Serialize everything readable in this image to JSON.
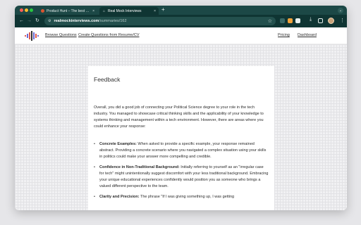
{
  "browser": {
    "tabs": [
      {
        "title": "Product Hunt – The best new",
        "favicon": "product-hunt-icon",
        "active": false
      },
      {
        "title": "Real Mock Interviews",
        "favicon": "site-icon",
        "active": true
      }
    ],
    "new_tab": "+",
    "tab_close": "×",
    "url": {
      "host": "realmockinterviews.com",
      "path": "/summaries/162"
    },
    "colors": {
      "frame": "#1c4846",
      "toolbar": "#0f3533",
      "omnibox": "#23504d"
    }
  },
  "site": {
    "nav": {
      "browse_questions": "Browse Questions",
      "create_from_resume": "Create Questions from Resume/CV",
      "pricing": "Pricing",
      "dashboard": "Dashboard"
    }
  },
  "feedback": {
    "title": "Feedback",
    "intro": "Overall, you did a good job of connecting your Political Science degree to your role in the tech industry. You managed to showcase critical thinking skills and the applicability of your knowledge to systems thinking and management within a tech environment. However, there are areas where you could enhance your response:",
    "items": [
      {
        "title": "Concrete Examples:",
        "body": "When asked to provide a specific example, your response remained abstract. Providing a concrete scenario where you navigated a complex situation using your skills in politics could make your answer more compelling and credible."
      },
      {
        "title": "Confidence in Non-Traditional Background:",
        "body": "Initially referring to yourself as an \"irregular case for tech\" might unintentionally suggest discomfort with your less traditional background. Embracing your unique educational experiences confidently would position you as someone who brings a valued different perspective to the team."
      },
      {
        "title": "Clarity and Precision:",
        "body": "The phrase \"If I was giving something up, I was getting"
      }
    ]
  }
}
